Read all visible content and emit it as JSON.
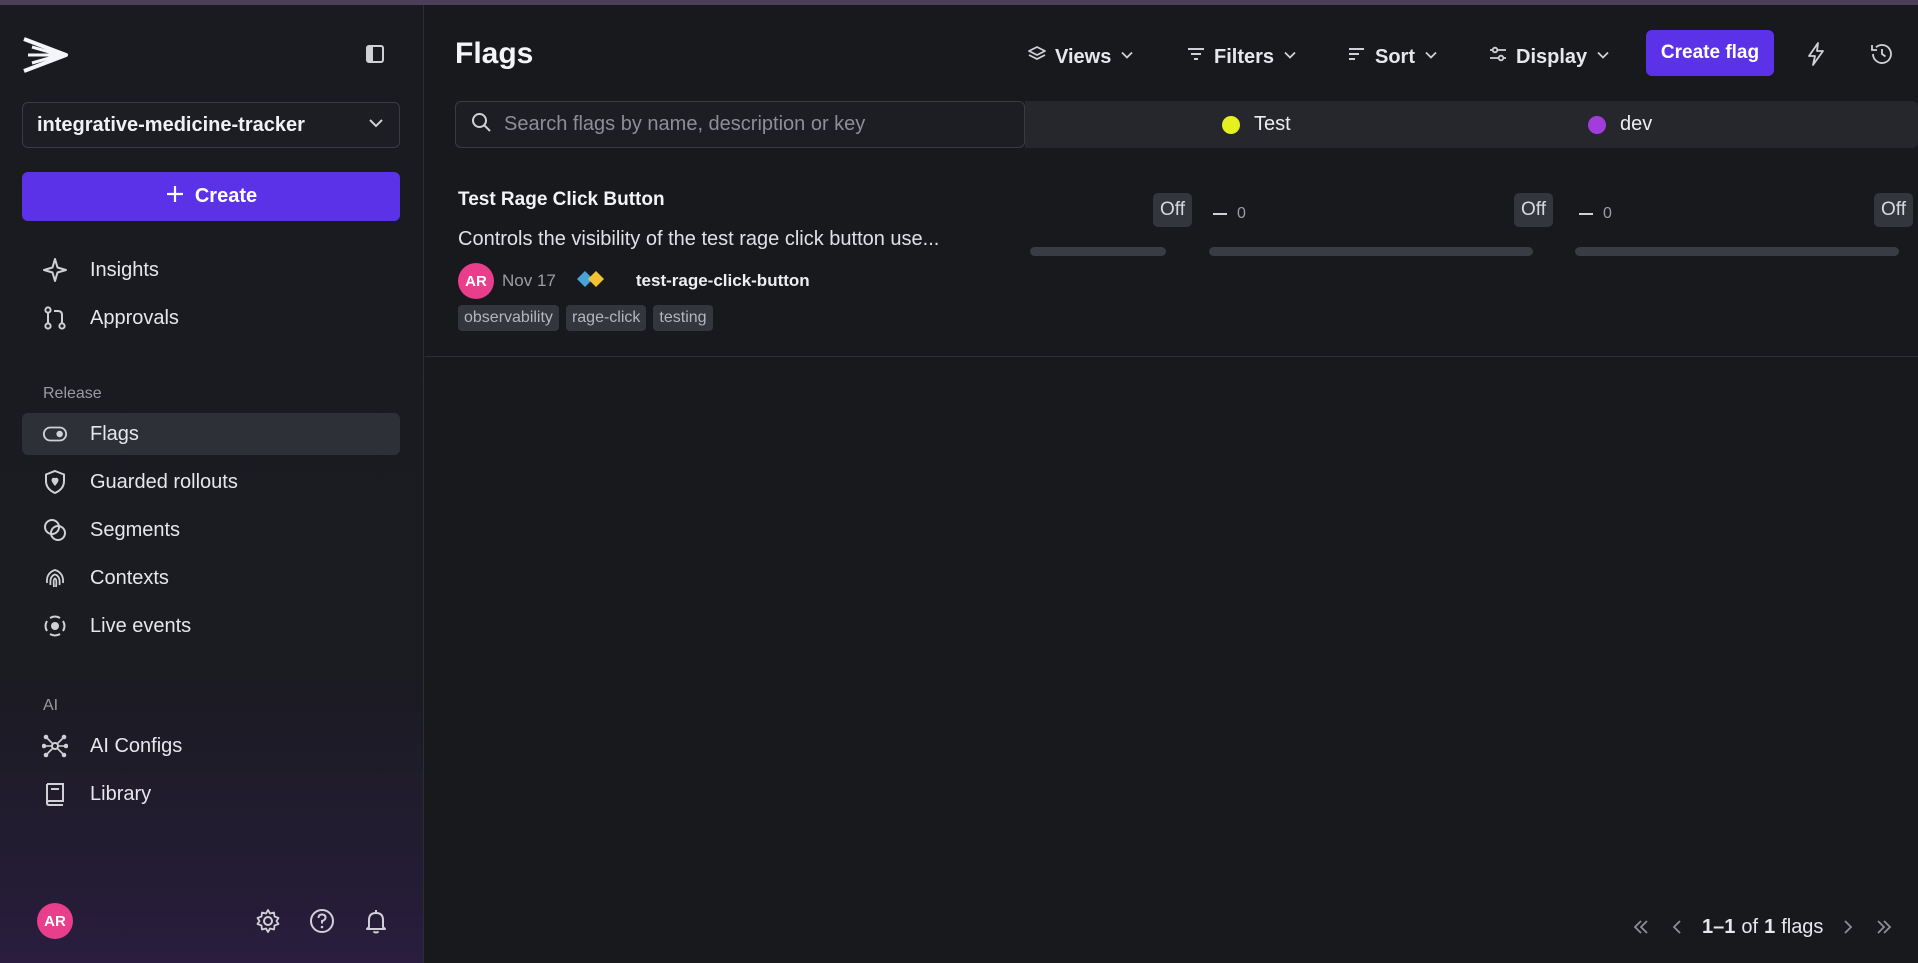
{
  "sidebar": {
    "project": "integrative-medicine-tracker",
    "create_label": "Create",
    "items_top": [
      {
        "label": "Insights",
        "icon": "sparkle-icon"
      },
      {
        "label": "Approvals",
        "icon": "git-branch-icon"
      }
    ],
    "section_release": "Release",
    "items_release": [
      {
        "label": "Flags",
        "icon": "toggle-icon",
        "active": true
      },
      {
        "label": "Guarded rollouts",
        "icon": "shield-icon"
      },
      {
        "label": "Segments",
        "icon": "segments-icon"
      },
      {
        "label": "Contexts",
        "icon": "fingerprint-icon"
      },
      {
        "label": "Live events",
        "icon": "live-icon"
      }
    ],
    "section_ai": "AI",
    "items_ai": [
      {
        "label": "AI Configs",
        "icon": "network-icon"
      },
      {
        "label": "Library",
        "icon": "book-icon"
      }
    ],
    "user_initials": "AR"
  },
  "header": {
    "title": "Flags",
    "views": "Views",
    "filters": "Filters",
    "sort": "Sort",
    "display": "Display",
    "create_flag": "Create flag"
  },
  "search": {
    "placeholder": "Search flags by name, description or key",
    "value": ""
  },
  "environments": [
    {
      "name": "Test",
      "color": "#e6f01e"
    },
    {
      "name": "dev",
      "color": "#a23cdc"
    }
  ],
  "flag": {
    "name": "Test Rage Click Button",
    "description": "Controls the visibility of the test rage click button use...",
    "maintainer_initials": "AR",
    "date": "Nov 17",
    "key": "test-rage-click-button",
    "tags": [
      "observability",
      "rage-click",
      "testing"
    ],
    "env_states": [
      {
        "dash": "",
        "count": "",
        "state": "Off"
      },
      {
        "dash": "–",
        "count": "0",
        "state": "Off"
      },
      {
        "dash": "–",
        "count": "0",
        "state": "Off"
      }
    ]
  },
  "pagination": {
    "range": "1–1",
    "of": "of",
    "total": "1",
    "unit": "flags"
  },
  "colors": {
    "accent": "#5b32e8",
    "avatar": "#e83e8c"
  }
}
